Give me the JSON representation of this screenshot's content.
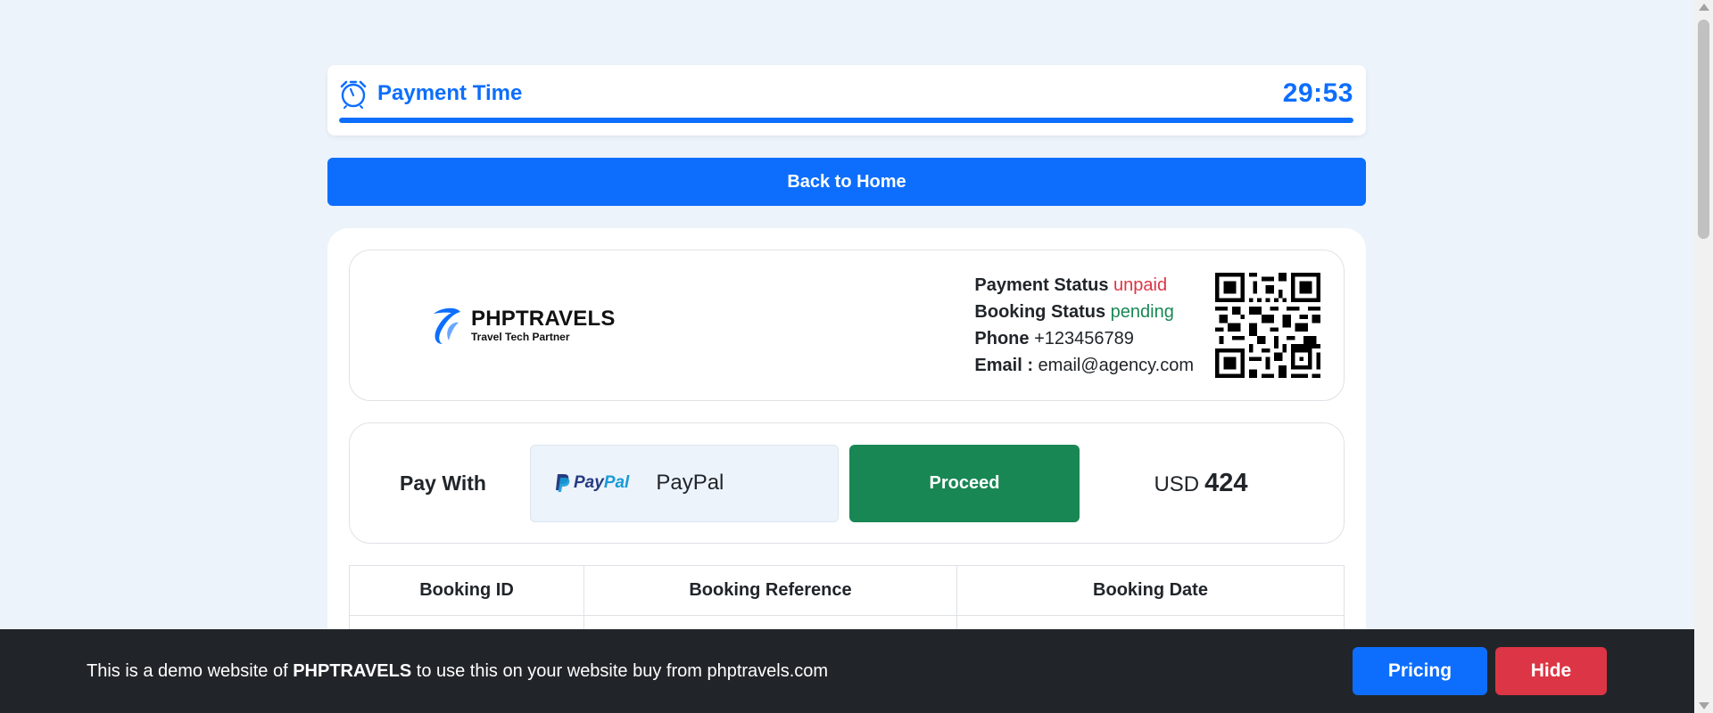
{
  "timer": {
    "title": "Payment Time",
    "countdown": "29:53",
    "progress_percent": 100,
    "icon": "alarm-clock-icon"
  },
  "nav": {
    "back_home_label": "Back to Home"
  },
  "invoice": {
    "brand": {
      "name": "PHPTRAVELS",
      "tagline": "Travel Tech Partner"
    },
    "payment_status_label": "Payment Status",
    "payment_status_value": "unpaid",
    "booking_status_label": "Booking Status",
    "booking_status_value": "pending",
    "phone_label": "Phone",
    "phone_value": "+123456789",
    "email_label": "Email :",
    "email_value": "email@agency.com"
  },
  "payment": {
    "label": "Pay With",
    "method_logo_pay": "Pay",
    "method_logo_pal": "Pal",
    "method_name": "PayPal",
    "proceed_label": "Proceed",
    "currency": "USD",
    "amount": "424"
  },
  "booking_table": {
    "headers": [
      "Booking ID",
      "Booking Reference",
      "Booking Date"
    ]
  },
  "demo_bar": {
    "text_before": "This is a demo website of ",
    "text_brand": "PHPTRAVELS",
    "text_after": " to use this on your website buy from phptravels.com",
    "pricing_label": "Pricing",
    "hide_label": "Hide"
  },
  "colors": {
    "primary": "#0d6efd",
    "success": "#198754",
    "danger": "#dc3545",
    "page_bg": "#edf3fb",
    "dark_bar": "#212529"
  }
}
